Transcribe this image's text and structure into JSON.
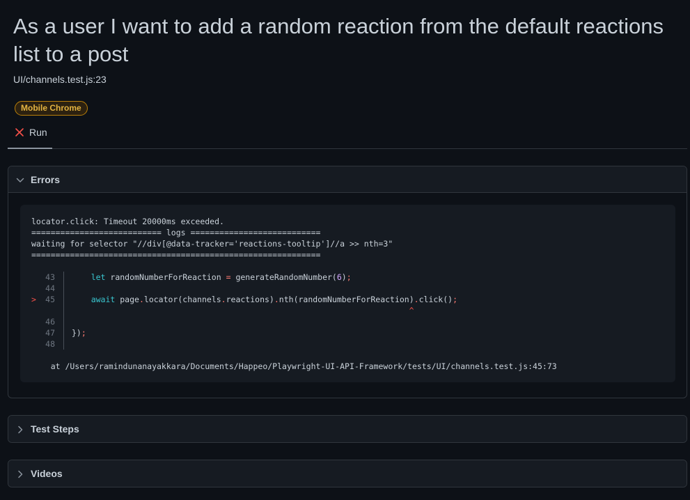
{
  "test": {
    "title": "As a user I want to add a random reaction from the default reactions list to a post",
    "location": "UI/channels.test.js:23",
    "project_badge": "Mobile Chrome"
  },
  "tabs": [
    {
      "label": "Run",
      "status": "failed",
      "icon": "x-icon"
    }
  ],
  "errors": {
    "title": "Errors",
    "message_lines": [
      "locator.click: Timeout 20000ms exceeded.",
      "=========================== logs ===========================",
      "waiting for selector \"//div[@data-tracker='reactions-tooltip']//a >> nth=3\"",
      "============================================================"
    ],
    "code_lines": [
      {
        "line": "43",
        "marker": "",
        "text": "    let randomNumberForReaction = generateRandomNumber(6);"
      },
      {
        "line": "44",
        "marker": "",
        "text": ""
      },
      {
        "line": "45",
        "marker": ">",
        "text": "    await page.locator(channels.reactions).nth(randomNumberForReaction).click();"
      },
      {
        "line": "",
        "marker": "",
        "text": "^"
      },
      {
        "line": "46",
        "marker": "",
        "text": ""
      },
      {
        "line": "47",
        "marker": "",
        "text": "});"
      },
      {
        "line": "48",
        "marker": "",
        "text": ""
      }
    ],
    "stack_line": "    at /Users/ramindunanayakkara/Documents/Happeo/Playwright-UI-API-Framework/tests/UI/channels.test.js:45:73"
  },
  "sections": {
    "test_steps": "Test Steps",
    "videos": "Videos"
  },
  "colors": {
    "background": "#0d1117",
    "badge_text": "#e3b341",
    "badge_border": "#bb8009",
    "fail": "#f85149",
    "keyword": "#39c5cf",
    "operator": "#ff7b72",
    "number": "#d2a8ff"
  }
}
